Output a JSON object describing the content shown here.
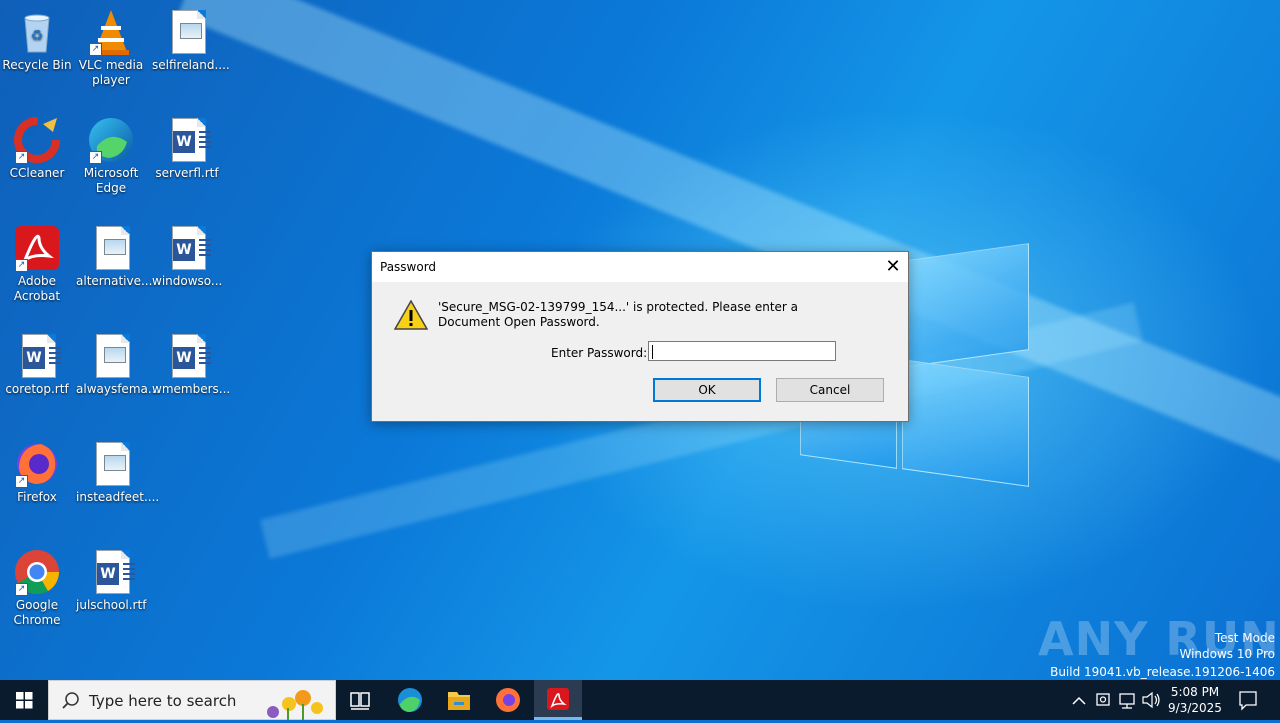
{
  "desktop": {
    "icons": [
      {
        "label": "Recycle Bin"
      },
      {
        "label": "VLC media player"
      },
      {
        "label": "selfireland...."
      },
      {
        "label": "CCleaner"
      },
      {
        "label": "Microsoft Edge"
      },
      {
        "label": "serverfl.rtf"
      },
      {
        "label": "Adobe Acrobat"
      },
      {
        "label": "alternative..."
      },
      {
        "label": "windowso..."
      },
      {
        "label": "coretop.rtf"
      },
      {
        "label": "alwaysfema..."
      },
      {
        "label": "wmembers..."
      },
      {
        "label": "Firefox"
      },
      {
        "label": "insteadfeet...."
      },
      {
        "label": "Google Chrome"
      },
      {
        "label": "julschool.rtf"
      }
    ]
  },
  "dialog": {
    "title": "Password",
    "message": "'Secure_MSG-02-139799_154...' is protected. Please enter a Document Open Password.",
    "password_label": "Enter Password:",
    "password_value": "",
    "ok_label": "OK",
    "cancel_label": "Cancel"
  },
  "watermark": {
    "brand": "ANY RUN",
    "mode": "Test Mode",
    "edition": "Windows 10 Pro",
    "build": "Build 19041.vb_release.191206-1406"
  },
  "taskbar": {
    "search_placeholder": "Type here to search",
    "time": "5:08 PM",
    "date": "9/3/2025",
    "pinned": [
      "task-view-icon",
      "edge-icon",
      "file-explorer-icon",
      "firefox-icon",
      "acrobat-icon"
    ]
  },
  "colors": {
    "accent": "#0078d7",
    "taskbar": "#0b1b2e",
    "desktop": "#0a6fd1"
  }
}
